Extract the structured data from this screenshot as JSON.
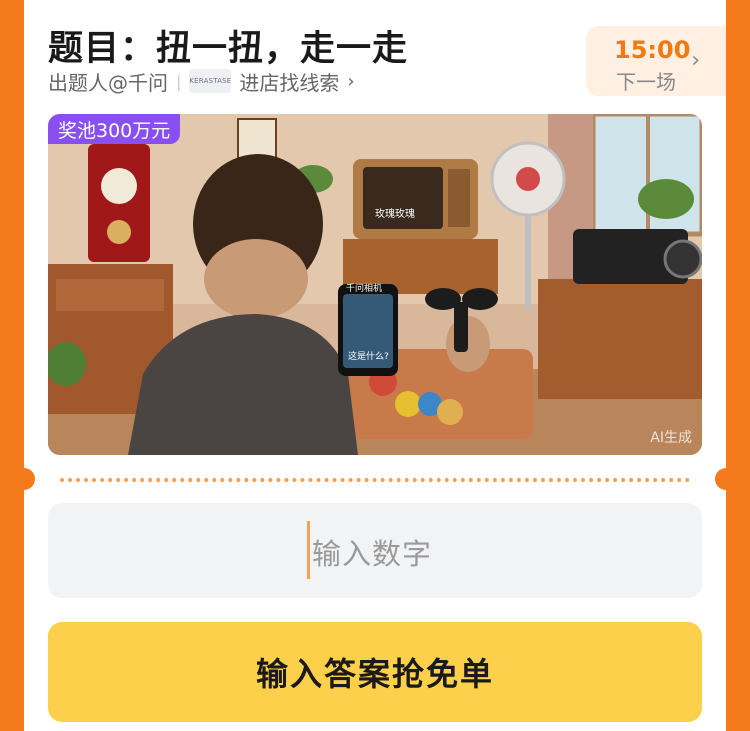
{
  "question": {
    "title": "题目：扭一扭，走一走",
    "author": "出题人@千问",
    "brand_logo_text": "KERASTASE",
    "clue_link": "进店找线索"
  },
  "timer": {
    "time": "15:00",
    "next_label": "下一场"
  },
  "image": {
    "prize_pool": "奖池300万元",
    "ai_tag": "AI生成",
    "tv_caption": "玫瑰玫瑰",
    "phone_header": "千问相机",
    "phone_caption": "这是什么?"
  },
  "answer": {
    "placeholder": "输入数字",
    "submit_label": "输入答案抢免单"
  },
  "colors": {
    "background": "#f47a1c",
    "timer_accent": "#f07a10",
    "badge": "#8a4ff0",
    "submit_button": "#fcd04a"
  }
}
